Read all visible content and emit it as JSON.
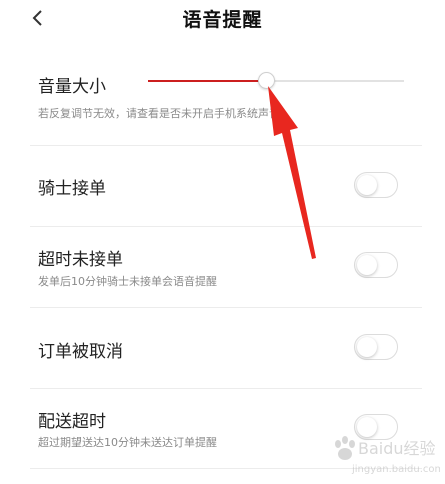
{
  "header": {
    "title": "语音提醒",
    "back_icon": "chevron-left-icon"
  },
  "volume": {
    "label": "音量大小",
    "hint": "若反复调节无效，请查看是否未开启手机系统声音",
    "level": 0.46,
    "accent_color": "#cc1f1f"
  },
  "settings": [
    {
      "title": "骑士接单",
      "subtitle": "",
      "enabled": false
    },
    {
      "title": "超时未接单",
      "subtitle": "发单后10分钟骑士未接单会语音提醒",
      "enabled": false
    },
    {
      "title": "订单被取消",
      "subtitle": "",
      "enabled": false
    },
    {
      "title": "配送超时",
      "subtitle": "超过期望送达10分钟未送达订单提醒",
      "enabled": false
    }
  ],
  "annotation": {
    "arrow_color": "#e8271f"
  },
  "watermark": {
    "brand": "Baidu经验",
    "url": "jingyan.baidu.com"
  }
}
